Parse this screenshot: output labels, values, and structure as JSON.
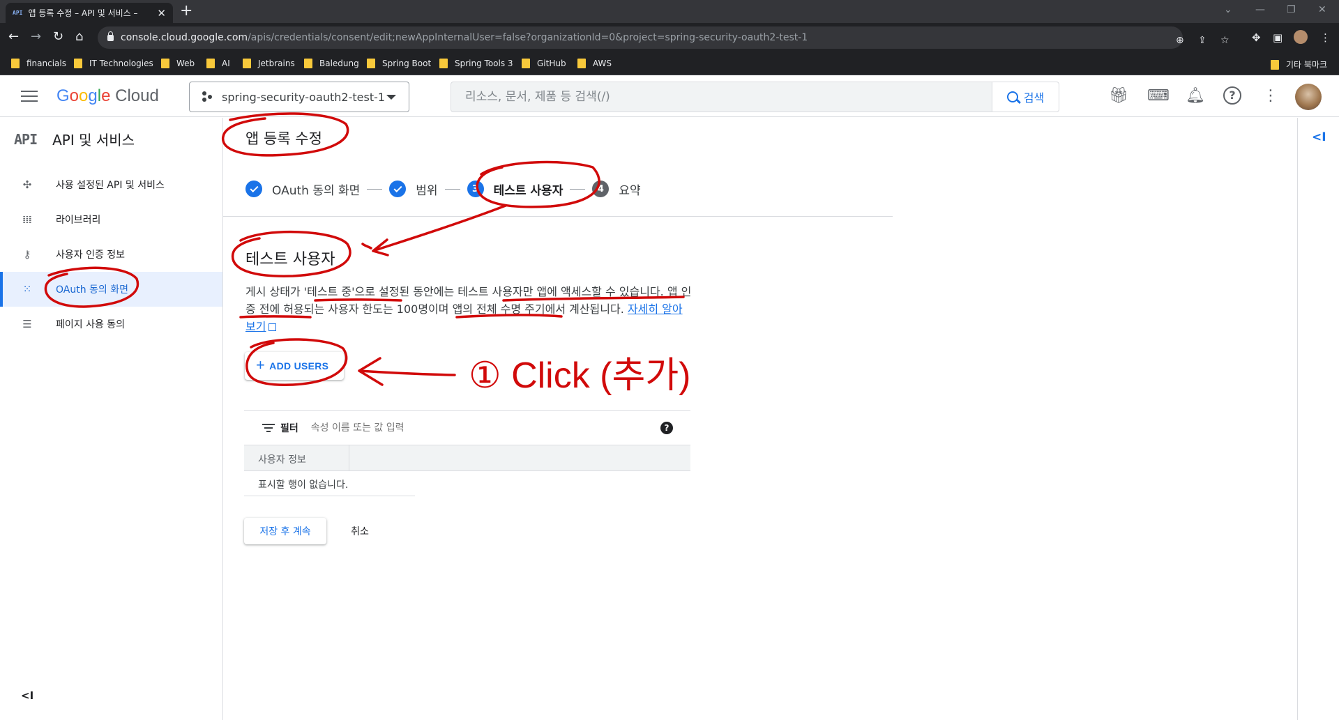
{
  "browser": {
    "tab_title": "앱 등록 수정 – API 및 서비스 –",
    "tab_favicon": "API",
    "url_host": "console.cloud.google.com",
    "url_path": "/apis/credentials/consent/edit;newAppInternalUser=false?organizationId=0&project=spring-security-oauth2-test-1",
    "bookmarks": [
      "financials",
      "IT Technologies",
      "Web",
      "AI",
      "Jetbrains",
      "Baledung",
      "Spring Boot",
      "Spring Tools 3",
      "GitHub",
      "AWS"
    ],
    "other_bookmarks": "기타 북마크"
  },
  "header": {
    "logo_google": "Google",
    "logo_cloud": "Cloud",
    "project_name": "spring-security-oauth2-test-1",
    "search_placeholder": "리소스, 문서, 제품 등 검색(/)",
    "search_button": "검색",
    "icons": [
      "gift-icon",
      "terminal-icon",
      "bell-icon",
      "help-icon",
      "more-vert-icon",
      "avatar"
    ]
  },
  "sidebar": {
    "badge": "API",
    "title": "API 및 서비스",
    "items": [
      {
        "label": "사용 설정된 API 및 서비스",
        "icon": "api-hub-icon"
      },
      {
        "label": "라이브러리",
        "icon": "library-icon"
      },
      {
        "label": "사용자 인증 정보",
        "icon": "key-icon"
      },
      {
        "label": "OAuth 동의 화면",
        "icon": "consent-grid-icon",
        "active": true
      },
      {
        "label": "페이지 사용 동의",
        "icon": "settings-list-icon"
      }
    ]
  },
  "main": {
    "page_title": "앱 등록 수정",
    "steps": [
      {
        "label": "OAuth 동의 화면",
        "state": "done"
      },
      {
        "label": "범위",
        "state": "done"
      },
      {
        "number": "3",
        "label": "테스트 사용자",
        "state": "current"
      },
      {
        "number": "4",
        "label": "요약",
        "state": "todo"
      }
    ],
    "section_title": "테스트 사용자",
    "description": "게시 상태가 '테스트 중'으로 설정된 동안에는 테스트 사용자만 앱에 액세스할 수 있습니다. 앱 인증 전에 허용되는 사용자 한도는 100명이며 앱의 전체 수명 주기에서 계산됩니다.",
    "learn_more": "자세히 알아보기",
    "add_users_button": "ADD USERS",
    "filter_label": "필터",
    "filter_placeholder": "속성 이름 또는 값 입력",
    "table_header": "사용자 정보",
    "table_empty": "표시할 행이 없습니다.",
    "save_button": "저장 후 계속",
    "cancel_button": "취소"
  },
  "annotation": {
    "color": "#d10a0a",
    "text": "① Click (추가)"
  }
}
